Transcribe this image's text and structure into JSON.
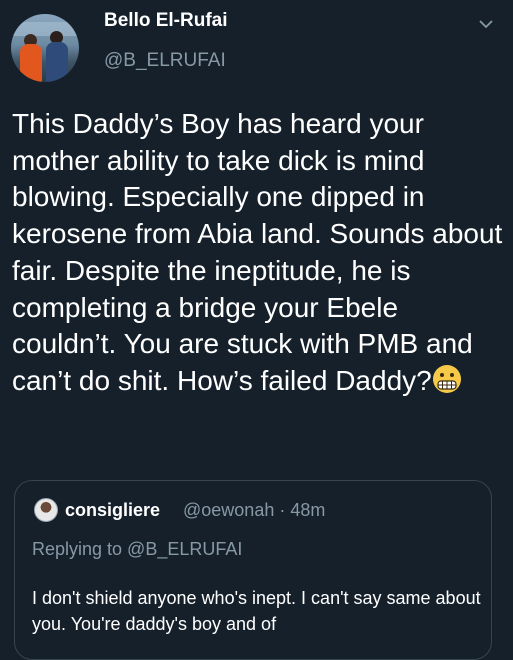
{
  "author": {
    "display_name": "Bello El-Rufai",
    "handle": "@B_ELRUFAI"
  },
  "tweet": {
    "text": "This Daddy’s Boy has heard your mother ability to take dick is mind blowing. Especially one dipped in kerosene from Abia land. Sounds about fair. Despite the ineptitude, he is completing a bridge your Ebele couldn’t. You are stuck with PMB and can’t do shit. How’s failed Daddy?",
    "trailing_emoji": "grimacing-face"
  },
  "quoted_tweet": {
    "name": "consigliere",
    "handle": "@oewonah",
    "separator": "·",
    "time": "48m",
    "replying_to": "Replying to @B_ELRUFAI",
    "text": "I don't shield anyone who's inept. I can't say same about you. You're daddy's boy and of"
  },
  "icons": [
    "chevron-down-icon"
  ],
  "colors": {
    "background": "#15202b",
    "secondary_text": "#8899a6",
    "border": "#38444d"
  }
}
